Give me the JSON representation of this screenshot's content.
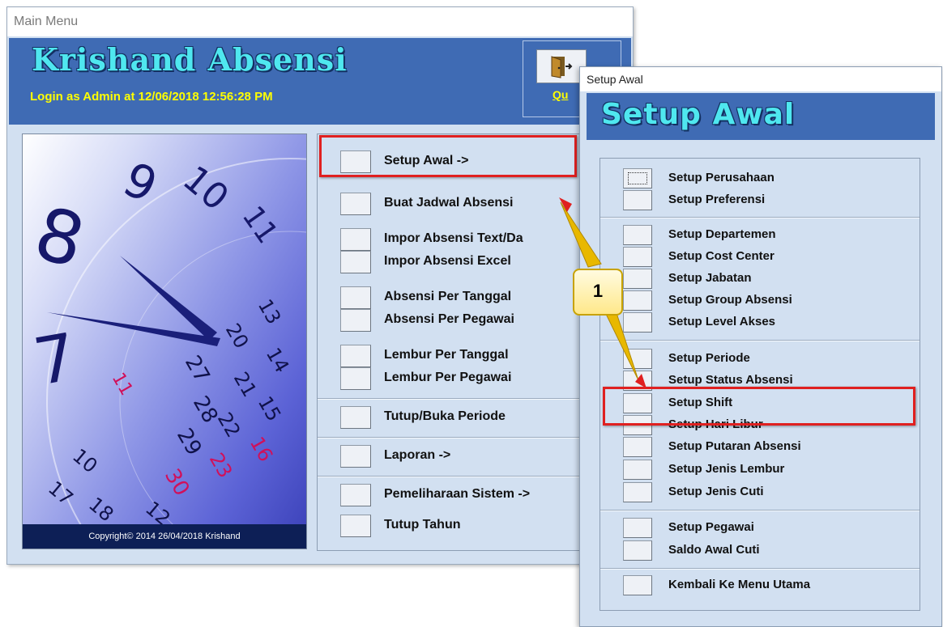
{
  "main_window": {
    "title": "Main Menu",
    "app_title": "Krishand Absensi",
    "login_text": "Login as Admin at 12/06/2018 12:56:28 PM",
    "quit_label": "Qu",
    "copyright": "Copyright© 2014  26/04/2018 Krishand",
    "menu_items": [
      {
        "label": "Setup Awal ->"
      },
      {
        "label": "Buat Jadwal Absensi"
      },
      {
        "label": "Impor Absensi Text/Da"
      },
      {
        "label": "Impor Absensi Excel"
      },
      {
        "label": "Absensi Per Tanggal"
      },
      {
        "label": "Absensi Per Pegawai"
      },
      {
        "label": "Lembur Per Tanggal"
      },
      {
        "label": "Lembur Per Pegawai"
      },
      {
        "label": "Tutup/Buka Periode"
      },
      {
        "label": "Laporan ->"
      },
      {
        "label": "Pemeliharaan Sistem ->"
      },
      {
        "label": "Tutup Tahun"
      }
    ]
  },
  "setup_window": {
    "title": "Setup Awal",
    "banner_title": "Setup Awal",
    "items": [
      {
        "label": "Setup Perusahaan"
      },
      {
        "label": "Setup Preferensi"
      },
      {
        "label": "Setup Departemen"
      },
      {
        "label": "Setup Cost Center"
      },
      {
        "label": "Setup Jabatan"
      },
      {
        "label": "Setup Group Absensi"
      },
      {
        "label": "Setup Level Akses"
      },
      {
        "label": "Setup Periode"
      },
      {
        "label": "Setup Status Absensi"
      },
      {
        "label": "Setup Shift"
      },
      {
        "label": "Setup Hari Libur"
      },
      {
        "label": "Setup Putaran Absensi"
      },
      {
        "label": "Setup Jenis Lembur"
      },
      {
        "label": "Setup Jenis Cuti"
      },
      {
        "label": "Setup Pegawai"
      },
      {
        "label": "Saldo Awal Cuti"
      },
      {
        "label": "Kembali Ke Menu Utama"
      }
    ]
  },
  "annotation": {
    "step_number": "1",
    "highlight_color": "#e02020",
    "callout_color": "#ffe88a"
  },
  "colors": {
    "window_bg": "#d2e0f1",
    "banner_bg": "#3f6bb4",
    "title_text": "#4fe7ef",
    "login_text": "#ffff00"
  },
  "icons": {
    "quit": "door-exit-icon",
    "hero": "clock-calendar-image"
  }
}
